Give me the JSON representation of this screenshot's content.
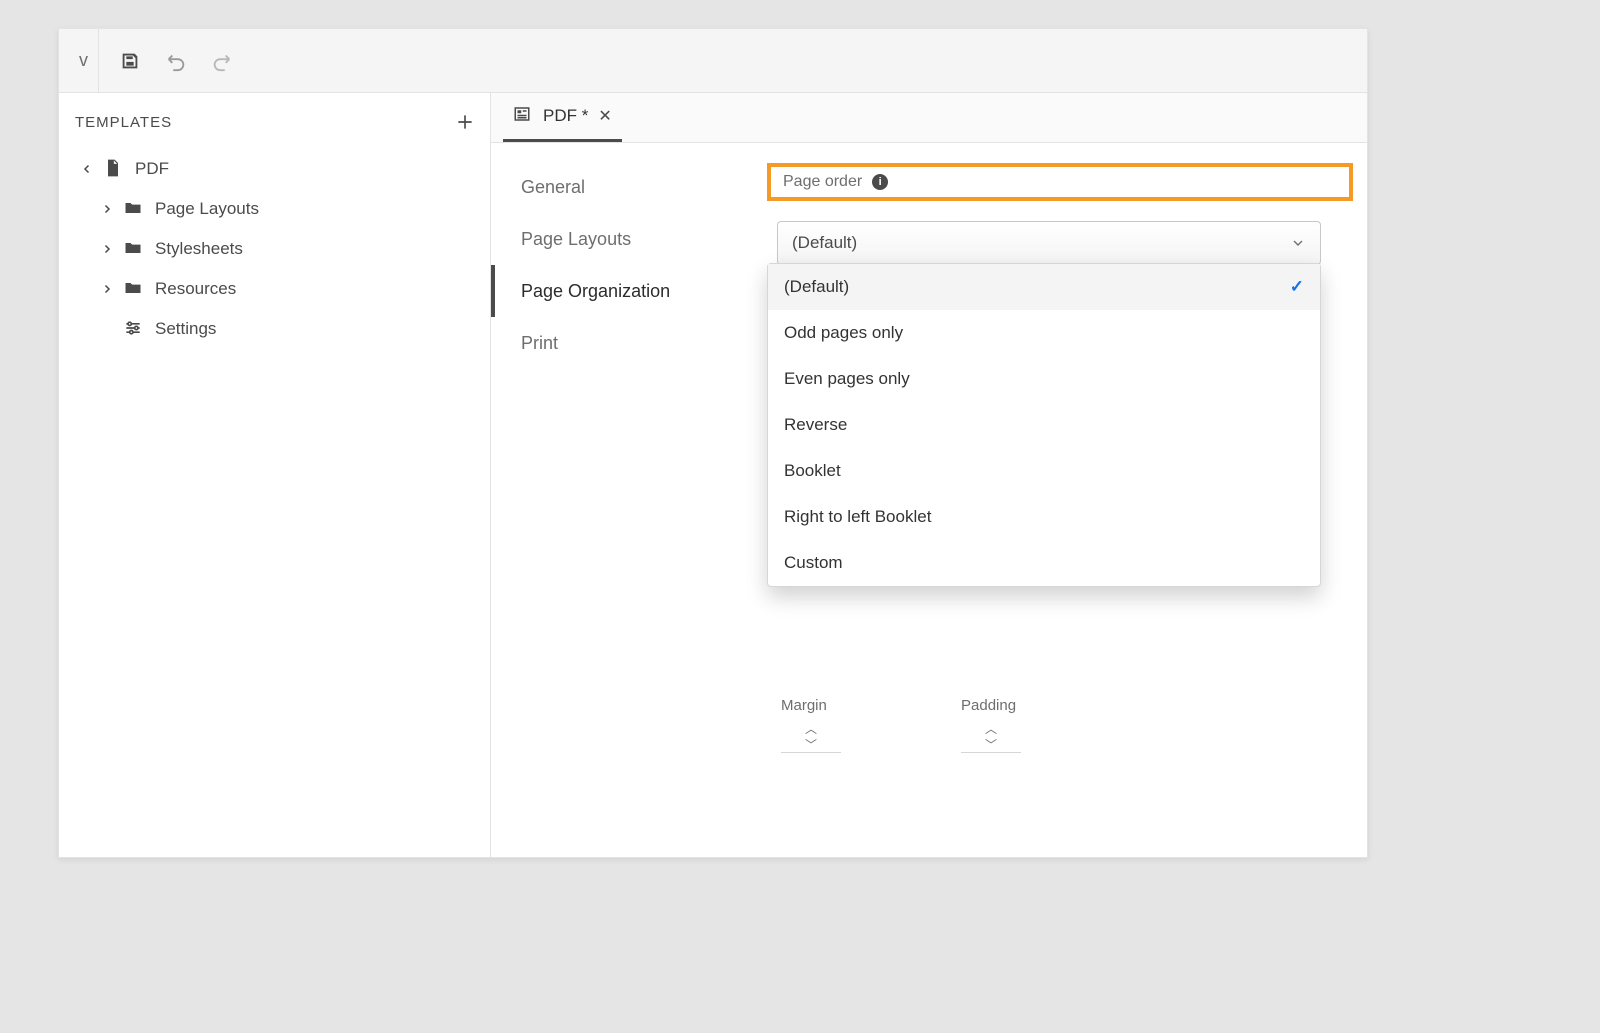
{
  "toolbar": {
    "view_stub": "v"
  },
  "sidebar": {
    "title": "TEMPLATES",
    "items": [
      {
        "label": "PDF"
      },
      {
        "label": "Page Layouts"
      },
      {
        "label": "Stylesheets"
      },
      {
        "label": "Resources"
      },
      {
        "label": "Settings"
      }
    ]
  },
  "tab": {
    "label": "PDF *"
  },
  "subnav": {
    "items": [
      {
        "label": "General"
      },
      {
        "label": "Page Layouts"
      },
      {
        "label": "Page Organization"
      },
      {
        "label": "Print"
      }
    ]
  },
  "page_order": {
    "label": "Page order",
    "selected": "(Default)",
    "options": [
      "(Default)",
      "Odd pages only",
      "Even pages only",
      "Reverse",
      "Booklet",
      "Right to left Booklet",
      "Custom"
    ]
  },
  "mp": {
    "margin_label": "Margin",
    "padding_label": "Padding"
  }
}
